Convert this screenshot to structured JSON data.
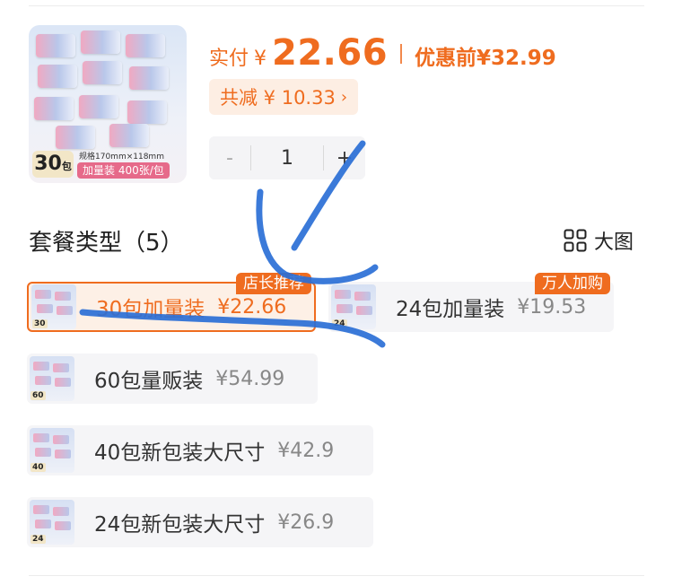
{
  "price": {
    "pay_label": "实付",
    "currency": "¥",
    "amount": "22.66",
    "original_label": "优惠前¥32.99"
  },
  "discount": {
    "label": "共减 ¥ 10.33",
    "chevron": "›"
  },
  "quantity": {
    "minus": "-",
    "value": "1",
    "plus": "+"
  },
  "product_image": {
    "badge_count": "30",
    "badge_unit": "包",
    "spec": "规格170mm×118mm",
    "variant": "加量装 400张/包"
  },
  "package": {
    "title": "套餐类型（5）",
    "view_label": "大图",
    "view_icon": "grid-icon"
  },
  "options": [
    {
      "name": "30包加量装",
      "price": "¥22.66",
      "badge": "店长推荐",
      "thumb_count": "30",
      "selected": true
    },
    {
      "name": "24包加量装",
      "price": "¥19.53",
      "badge": "万人加购",
      "thumb_count": "24",
      "selected": false
    },
    {
      "name": "60包量贩装",
      "price": "¥54.99",
      "badge": "",
      "thumb_count": "60",
      "selected": false
    },
    {
      "name": "40包新包装大尺寸",
      "price": "¥42.9",
      "badge": "",
      "thumb_count": "40",
      "selected": false
    },
    {
      "name": "24包新包装大尺寸",
      "price": "¥26.9",
      "badge": "",
      "thumb_count": "24",
      "selected": false
    }
  ],
  "colors": {
    "accent": "#ef6c1f",
    "scribble": "#2b6fd6"
  }
}
